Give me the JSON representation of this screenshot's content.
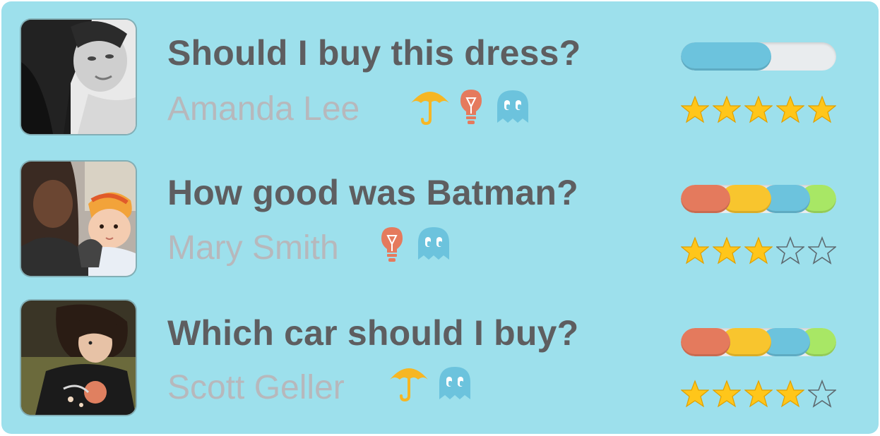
{
  "colors": {
    "panel_bg": "#9de0ec",
    "title_text": "#5e5e60",
    "author_text": "#b7b8bc",
    "umbrella": "#f6b623",
    "bulb": "#e57a5d",
    "ghost": "#6cc3dd",
    "bar_red": "#e47a5d",
    "bar_yellow": "#f8c52e",
    "bar_blue": "#6cc3dd",
    "bar_green": "#a8e765",
    "bar_empty": "#e9ecee",
    "star_filled": "#ffc61a"
  },
  "questions": [
    {
      "title": "Should I buy this dress?",
      "author": "Amanda Lee",
      "tag_icons": [
        "umbrella-icon",
        "lightbulb-icon",
        "ghost-icon"
      ],
      "avatar": "photo-woman-black-and-white",
      "poll_progress": 0.58,
      "rating": 5,
      "rating_max": 5
    },
    {
      "title": "How good was Batman?",
      "author": "Mary Smith",
      "tag_icons": [
        "lightbulb-icon",
        "ghost-icon"
      ],
      "avatar": "photo-mother-and-child",
      "poll_progress": 1.0,
      "rating": 3,
      "rating_max": 5
    },
    {
      "title": "Which car should I buy?",
      "author": "Scott Geller",
      "tag_icons": [
        "umbrella-icon",
        "ghost-icon"
      ],
      "avatar": "photo-young-man",
      "poll_progress": 1.0,
      "rating": 4,
      "rating_max": 5
    }
  ]
}
